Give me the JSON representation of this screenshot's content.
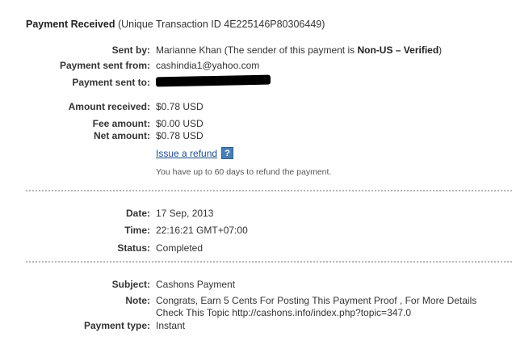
{
  "header": {
    "title_bold": "Payment Received",
    "title_rest": " (Unique Transaction ID 4E225146P80306449)"
  },
  "sender": {
    "sent_by_label": "Sent by:",
    "sent_by_value": "Marianne Khan (The sender of this payment is ",
    "sent_by_status": "Non-US – Verified",
    "sent_by_close": ")",
    "sent_from_label": "Payment sent from:",
    "sent_from_value": "cashindia1@yahoo.com",
    "sent_to_label": "Payment sent to:"
  },
  "amounts": {
    "received_label": "Amount received:",
    "received_value": "$0.78 USD",
    "fee_label": "Fee amount:",
    "fee_value": "$0.00 USD",
    "net_label": "Net amount:",
    "net_value": "$0.78 USD",
    "refund_link": "Issue a refund",
    "help_icon_text": "?",
    "refund_note": "You have up to 60 days to refund the payment."
  },
  "details": {
    "date_label": "Date:",
    "date_value": "17 Sep, 2013",
    "time_label": "Time:",
    "time_value": "22:16:21 GMT+07:00",
    "status_label": "Status:",
    "status_value": "Completed"
  },
  "message": {
    "subject_label": "Subject:",
    "subject_value": "Cashons Payment",
    "note_label": "Note:",
    "note_line1": "Congrats, Earn 5 Cents For Posting This Payment Proof , For More Details",
    "note_line2": "Check This Topic http://cashons.info/index.php?topic=347.0",
    "type_label": "Payment type:",
    "type_value": "Instant"
  }
}
